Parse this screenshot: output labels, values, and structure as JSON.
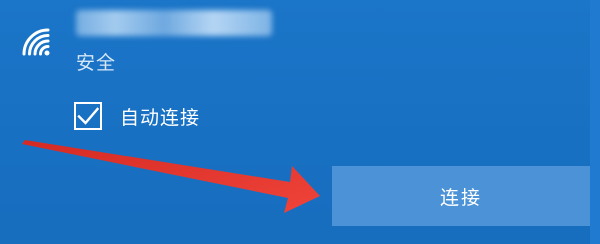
{
  "network": {
    "icon": "wifi-icon",
    "security": "安全",
    "auto_connect_label": "自动连接",
    "auto_connect_checked": true,
    "connect_label": "连接"
  },
  "annotation": {
    "arrow_color": "#e8322b",
    "target": "connect-button"
  },
  "colors": {
    "background": "#1a72c4",
    "button": "#4b93d6",
    "text": "#ffffff"
  }
}
